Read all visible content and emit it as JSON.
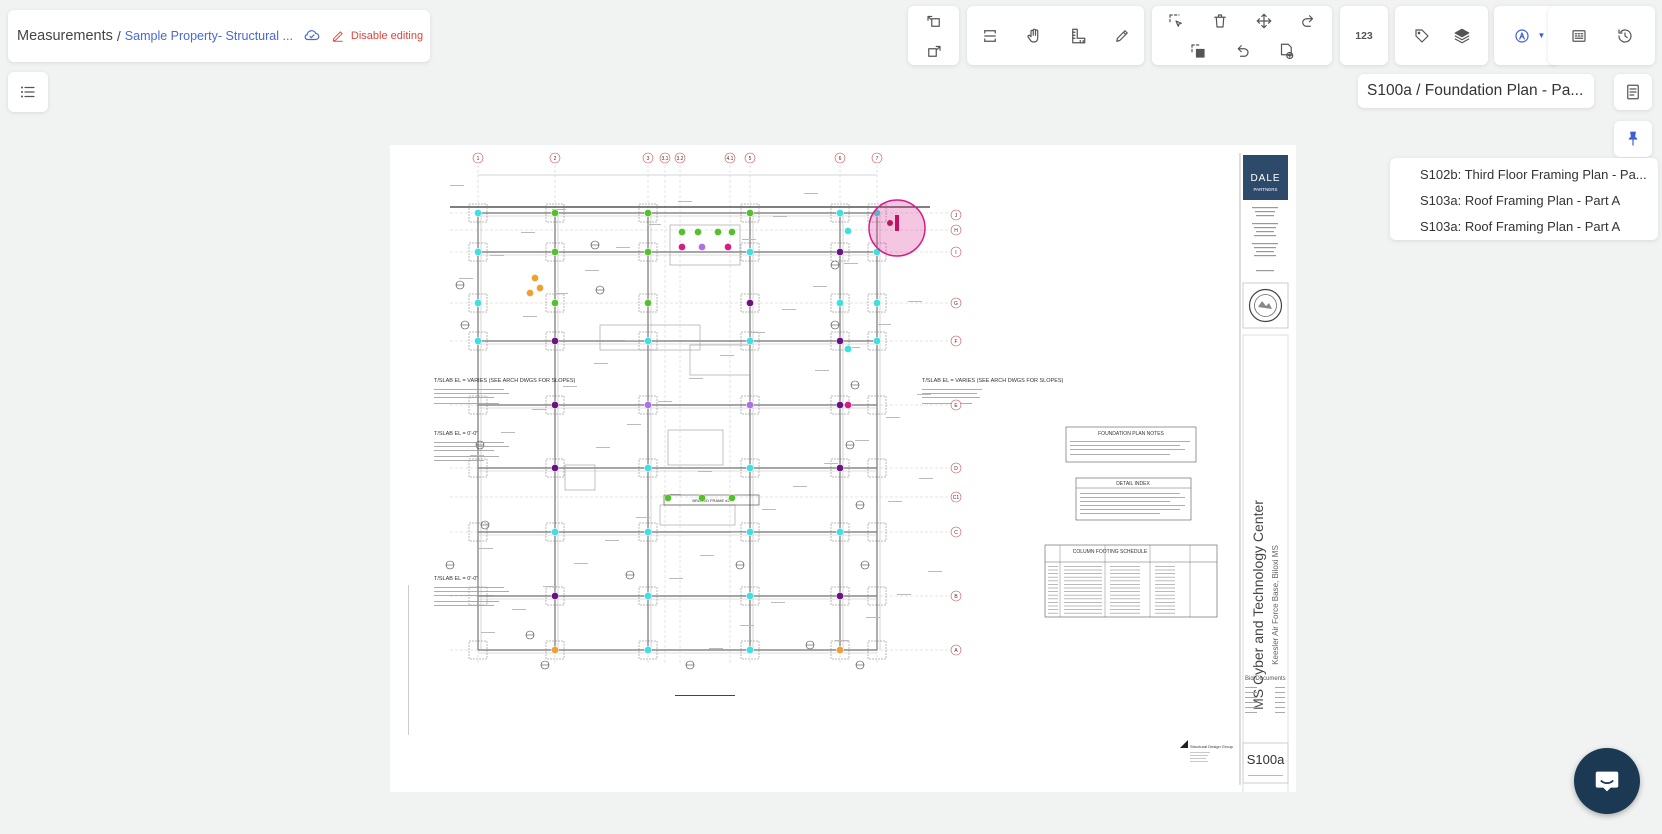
{
  "breadcrumb": {
    "root": "Measurements",
    "separator": "/",
    "property": "Sample Property- Structural ...",
    "disable_editing": "Disable editing"
  },
  "toolbar": {
    "count_label": "123"
  },
  "sheet": {
    "title": "S100a / Foundation Plan - Pa..."
  },
  "sheet_list": [
    "S102b: Third Floor Framing Plan - Pa...",
    "S103a: Roof Framing Plan - Part A",
    "S103a: Roof Framing Plan - Part A"
  ],
  "drawing": {
    "firm_name": "DALE",
    "firm_sub": "PARTNERS",
    "project_title": "MS Cyber and Technology Center",
    "project_location": "Keesler Air Force Base, Biloxi MS",
    "sheet_number": "S100a",
    "bid_documents": "Bid Documents",
    "structural_firm": "Structural Design Group",
    "notes_title": "FOUNDATION PLAN NOTES",
    "detail_index_title": "DETAIL INDEX",
    "schedule_title": "COLUMN FOOTING SCHEDULE",
    "braced_frame_label": "BRACED FRAME #2",
    "slab_notes": [
      "T/SLAB EL = VARIES (SEE ARCH DWGS FOR SLOPES)",
      "T/SLAB EL = 0'-0\"",
      "T/SLAB EL = 0'-0\""
    ],
    "slab_note_right": "T/SLAB EL = VARIES (SEE ARCH DWGS FOR SLOPES)",
    "grid_numbers": [
      "1",
      "2",
      "3",
      "3.1",
      "3.2",
      "4.1",
      "5",
      "6",
      "7"
    ],
    "grid_letters": [
      "J",
      "H",
      "I",
      "G",
      "F",
      "E",
      "D",
      "C1",
      "C",
      "B",
      "A"
    ]
  },
  "colors": {
    "accent": "#4a67d6",
    "danger": "#e0443c",
    "chat_bg": "#1b3953",
    "marker_green": "#55c12a",
    "marker_cyan": "#3ee0e0",
    "marker_purple": "#6b1280",
    "marker_violet": "#b06ee8",
    "marker_magenta": "#d81b8a",
    "marker_orange": "#f0a030"
  },
  "icons": {
    "cloud": "cloud-icon",
    "pencil": "pencil-icon",
    "list": "list-icon",
    "chat": "chat-icon"
  }
}
